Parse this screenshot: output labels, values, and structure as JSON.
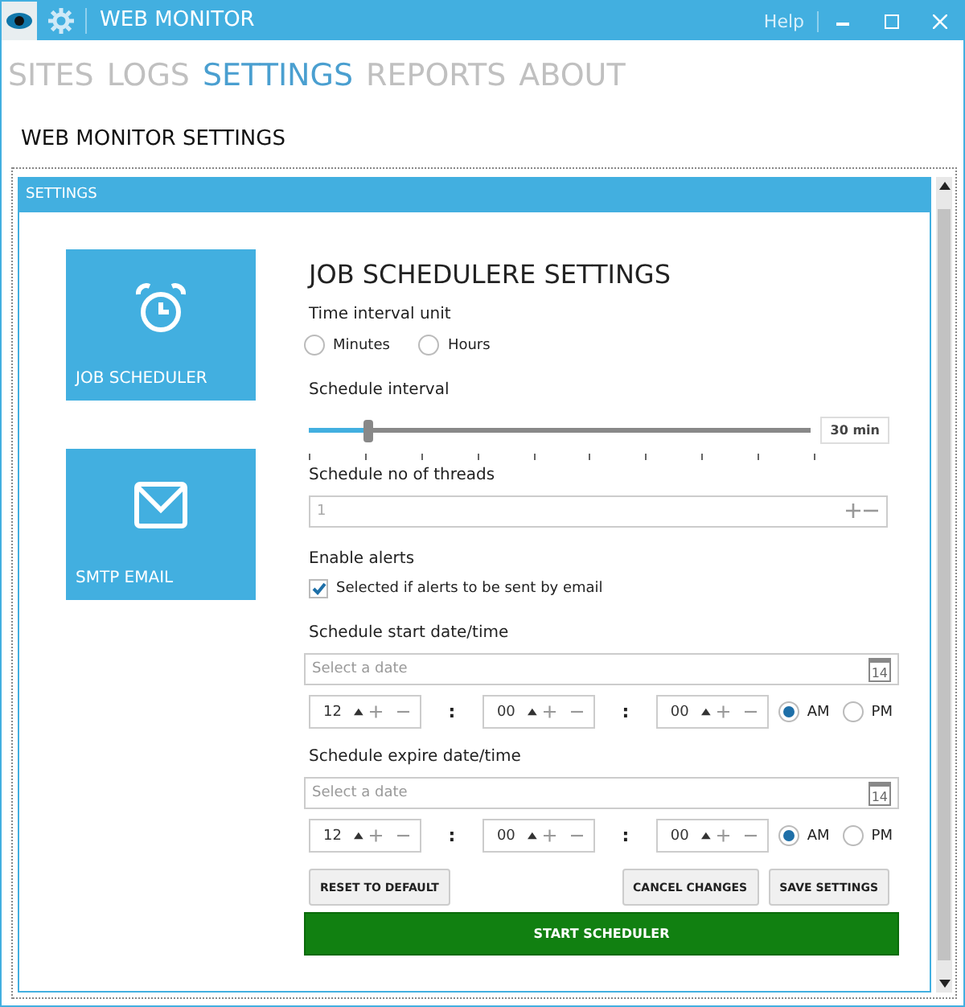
{
  "window": {
    "title": "WEB MONITOR",
    "help": "Help"
  },
  "nav": [
    {
      "label": "SITES",
      "selected": false
    },
    {
      "label": "LOGS",
      "selected": false
    },
    {
      "label": "SETTINGS",
      "selected": true
    },
    {
      "label": "REPORTS",
      "selected": false
    },
    {
      "label": "ABOUT",
      "selected": false
    }
  ],
  "page_title": "WEB MONITOR SETTINGS",
  "panel": {
    "header": "SETTINGS"
  },
  "tiles": [
    {
      "label": "JOB SCHEDULER",
      "kind": "alarm"
    },
    {
      "label": "SMTP EMAIL",
      "kind": "mail"
    }
  ],
  "form": {
    "heading": "JOB SCHEDULERE SETTINGS",
    "interval_unit": {
      "label": "Time interval unit",
      "options": [
        {
          "label": "Minutes",
          "selected": false
        },
        {
          "label": "Hours",
          "selected": false
        }
      ]
    },
    "interval": {
      "label": "Schedule interval",
      "level": 0.12,
      "reading": "30 min"
    },
    "threads": {
      "label": "Schedule no of threads",
      "placeholder": "1"
    },
    "alerts": {
      "label": "Enable alerts",
      "checkbox": {
        "label": "Selected if alerts to be sent by email",
        "checked": true
      }
    },
    "schedules": [
      {
        "label": "Schedule start date/time",
        "placeholder": "Select a date",
        "calendar_day": "14",
        "parts": [
          {
            "kind": "field",
            "value": "12"
          },
          {
            "kind": "separator",
            "text": ":"
          },
          {
            "kind": "field",
            "value": "00"
          },
          {
            "kind": "separator",
            "text": ":"
          },
          {
            "kind": "field",
            "value": "00"
          }
        ],
        "meridiem": [
          {
            "label": "AM",
            "selected": true
          },
          {
            "label": "PM",
            "selected": false
          }
        ]
      },
      {
        "label": "Schedule expire date/time",
        "placeholder": "Select a date",
        "calendar_day": "14",
        "parts": [
          {
            "kind": "field",
            "value": "12"
          },
          {
            "kind": "separator",
            "text": ":"
          },
          {
            "kind": "field",
            "value": "00"
          },
          {
            "kind": "separator",
            "text": ":"
          },
          {
            "kind": "field",
            "value": "00"
          }
        ],
        "meridiem": [
          {
            "label": "AM",
            "selected": true
          },
          {
            "label": "PM",
            "selected": false
          }
        ]
      }
    ],
    "buttons": [
      {
        "label": "RESET TO DEFAULT",
        "kind": "left"
      },
      {
        "label": "CANCEL CHANGES",
        "kind": "right"
      },
      {
        "label": "SAVE SETTINGS",
        "kind": "right"
      }
    ],
    "start_button": "START SCHEDULER"
  }
}
